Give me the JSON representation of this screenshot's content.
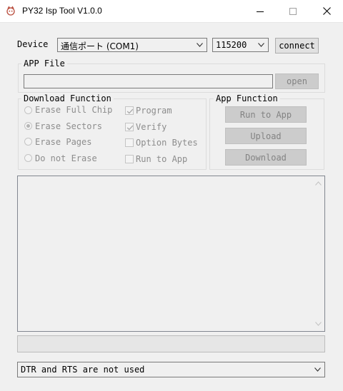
{
  "window": {
    "title": "PY32 Isp Tool V1.0.0",
    "icon": "app-icon",
    "controls": [
      "minimize-icon",
      "maximize-icon",
      "close-icon"
    ]
  },
  "device": {
    "label": "Device",
    "port_value": "通信ポート (COM1)",
    "baud_value": "115200",
    "connect_label": "connect"
  },
  "app_file": {
    "group_title": "APP File",
    "path_value": "",
    "open_label": "open"
  },
  "download_function": {
    "group_title": "Download Function",
    "erase_options": [
      {
        "label": "Erase Full Chip",
        "checked": false
      },
      {
        "label": "Erase Sectors",
        "checked": true
      },
      {
        "label": "Erase Pages",
        "checked": false
      },
      {
        "label": "Do not Erase",
        "checked": false
      }
    ],
    "actions": [
      {
        "label": "Program",
        "checked": true
      },
      {
        "label": "Verify",
        "checked": true
      },
      {
        "label": "Option Bytes",
        "checked": false
      },
      {
        "label": "Run to App",
        "checked": false
      }
    ]
  },
  "app_function": {
    "group_title": "App Function",
    "run_label": "Run to App",
    "upload_label": "Upload",
    "download_label": "Download"
  },
  "log": {
    "text": ""
  },
  "progress": {
    "value": 0
  },
  "serial_mode": {
    "value": "DTR and RTS are not used"
  },
  "colors": {
    "window_bg": "#f0f0f0",
    "titlebar_bg": "#ffffff",
    "disabled_text": "#838383",
    "disabled_button_bg": "#cccccc"
  }
}
